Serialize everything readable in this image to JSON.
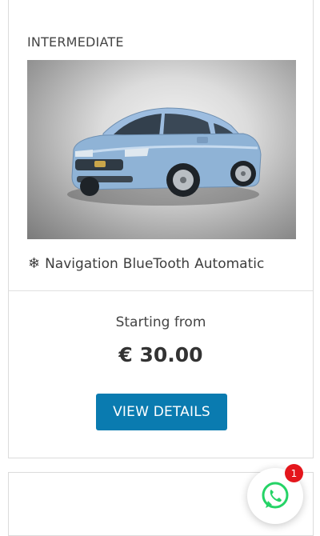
{
  "listing": {
    "category": "INTERMEDIATE",
    "image_alt": "Light blue sedan car",
    "feature_icon": "snowflake-icon",
    "features": [
      "Navigation",
      "BlueTooth",
      "Automatic"
    ],
    "starting_label": "Starting from",
    "price": "€ 30.00",
    "details_button": "VIEW DETAILS"
  },
  "whatsapp": {
    "icon": "whatsapp-icon",
    "badge_count": "1",
    "color": "#25d366"
  },
  "colors": {
    "button": "#0a7bb0",
    "badge": "#e4161c",
    "car_body": "#8fb3d6"
  }
}
